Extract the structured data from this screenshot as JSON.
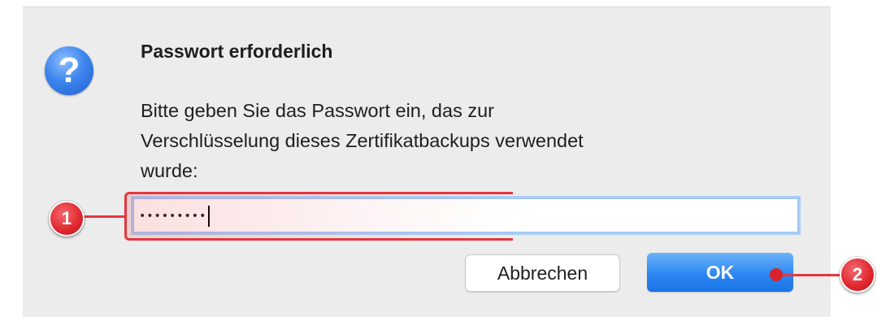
{
  "dialog": {
    "icon": "question-mark-icon",
    "icon_glyph": "?",
    "title": "Passwort erforderlich",
    "message_lines": [
      "Bitte geben Sie das Passwort ein, das zur",
      "Verschlüsselung dieses Zertifikatbackups verwendet",
      "wurde:"
    ],
    "password_masked": "•••••••••",
    "cancel_label": "Abbrechen",
    "ok_label": "OK"
  },
  "annotations": {
    "marker_1": "1",
    "marker_2": "2",
    "highlight_color": "#e6363d"
  },
  "colors": {
    "dialog_bg": "#ececec",
    "accent_blue": "#2c87f2",
    "focus_ring": "#a9cdf6"
  }
}
